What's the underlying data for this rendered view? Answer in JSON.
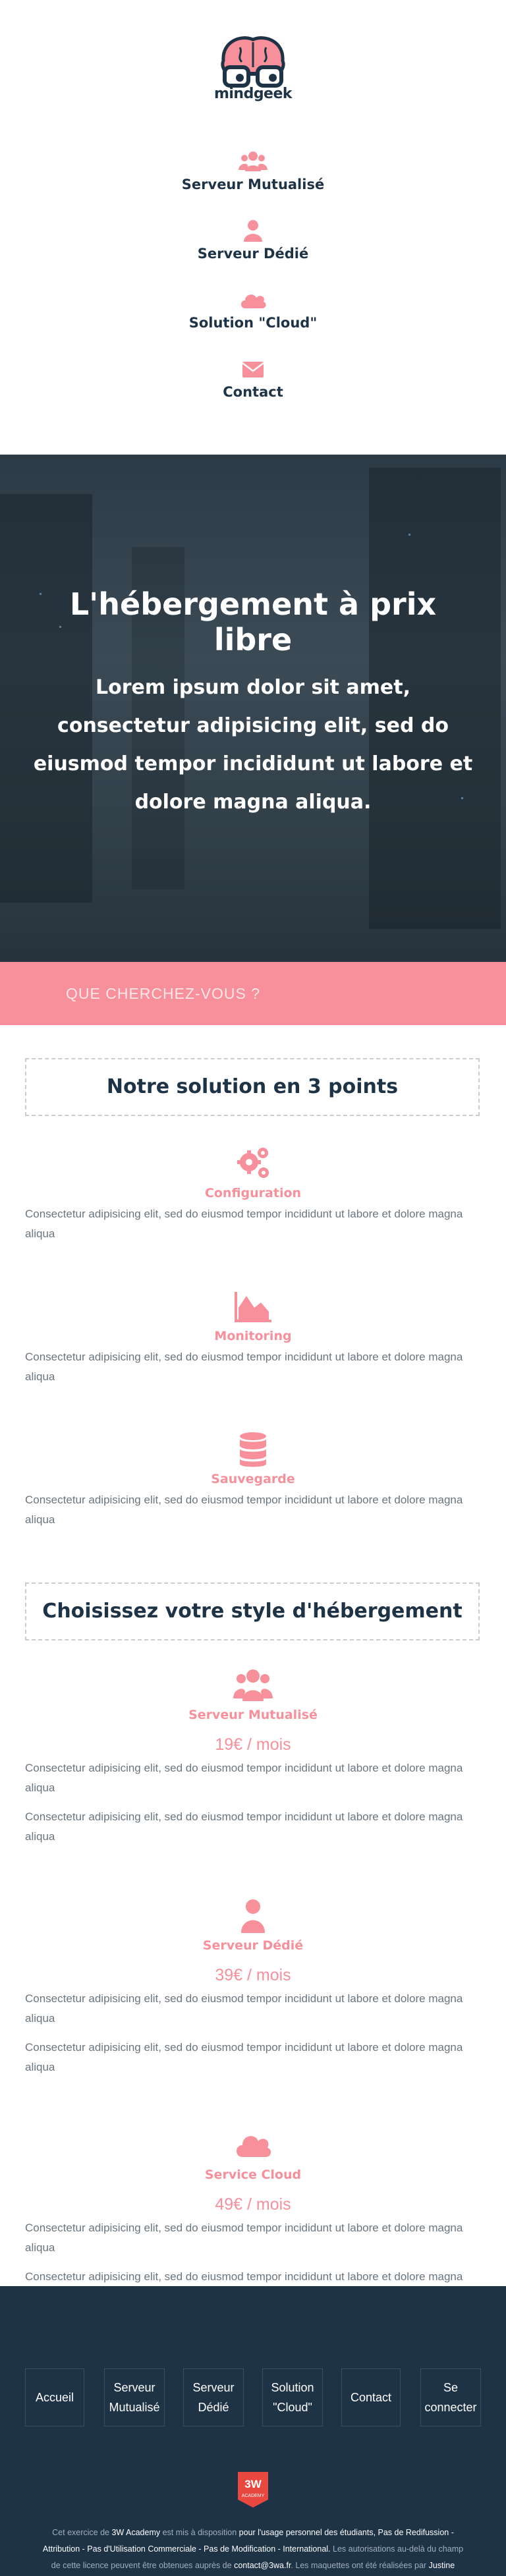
{
  "brand": {
    "name": "mindgeek"
  },
  "nav": [
    {
      "label": "Serveur Mutualisé",
      "icon": "users-icon"
    },
    {
      "label": "Serveur Dédié",
      "icon": "user-icon"
    },
    {
      "label": "Solution \"Cloud\"",
      "icon": "cloud-icon"
    },
    {
      "label": "Contact",
      "icon": "envelope-icon"
    }
  ],
  "hero": {
    "title": "L'hébergement à prix libre",
    "subtitle": "Lorem ipsum dolor sit amet, consectetur adipisicing elit, sed do eiusmod tempor incididunt ut labore et dolore magna aliqua."
  },
  "search": {
    "placeholder": "QUE CHERCHEZ-VOUS ?",
    "value": ""
  },
  "solution": {
    "title": "Notre solution en 3 points",
    "items": [
      {
        "title": "Configuration",
        "icon": "gears-icon",
        "desc": "Consectetur adipisicing elit, sed do eiusmod tempor incididunt ut labore et dolore magna aliqua"
      },
      {
        "title": "Monitoring",
        "icon": "area-chart-icon",
        "desc": "Consectetur adipisicing elit, sed do eiusmod tempor incididunt ut labore et dolore magna aliqua"
      },
      {
        "title": "Sauvegarde",
        "icon": "database-icon",
        "desc": "Consectetur adipisicing elit, sed do eiusmod tempor incididunt ut labore et dolore magna aliqua"
      }
    ]
  },
  "hosting": {
    "title": "Choisissez votre style d'hébergement",
    "items": [
      {
        "title": "Serveur Mutualisé",
        "price": "19€ / mois",
        "icon": "users-icon",
        "desc1": "Consectetur adipisicing elit, sed do eiusmod tempor incididunt ut labore et dolore magna aliqua",
        "desc2": "Consectetur adipisicing elit, sed do eiusmod tempor incididunt ut labore et dolore magna aliqua"
      },
      {
        "title": "Serveur Dédié",
        "price": "39€ / mois",
        "icon": "user-icon",
        "desc1": "Consectetur adipisicing elit, sed do eiusmod tempor incididunt ut labore et dolore magna aliqua",
        "desc2": "Consectetur adipisicing elit, sed do eiusmod tempor incididunt ut labore et dolore magna aliqua"
      },
      {
        "title": "Service Cloud",
        "price": "49€ / mois",
        "icon": "cloud-icon",
        "desc1": "Consectetur adipisicing elit, sed do eiusmod tempor incididunt ut labore et dolore magna aliqua",
        "desc2": "Consectetur adipisicing elit, sed do eiusmod tempor incididunt ut labore et dolore magna aliqua"
      }
    ]
  },
  "footer": {
    "buttons": [
      {
        "label": "Accueil"
      },
      {
        "label": "Serveur Mutualisé"
      },
      {
        "label": "Serveur Dédié"
      },
      {
        "label": "Solution \"Cloud\""
      },
      {
        "label": "Contact"
      },
      {
        "label": "Se connecter"
      }
    ],
    "badge": "3W ACADEMY",
    "legal": {
      "p1": "Cet exercice de",
      "org": "3W Academy",
      "p2": "est mis à disposition",
      "p3": "pour l'usage personnel des étudiants, Pas de Redifussion - Attribution - Pas d'Utilisation Commerciale - Pas de Modification - International.",
      "p4": "Les autorisations au-delà du champ de cette licence peuvent être obtenues auprès de",
      "email": "contact@3wa.fr",
      "p5": ". Les maquettes ont été réalisées par",
      "author": "Justine Muller",
      "p6": "."
    }
  },
  "colors": {
    "accent": "#f7909b",
    "navy": "#1f3346",
    "text": "#6b757d"
  }
}
